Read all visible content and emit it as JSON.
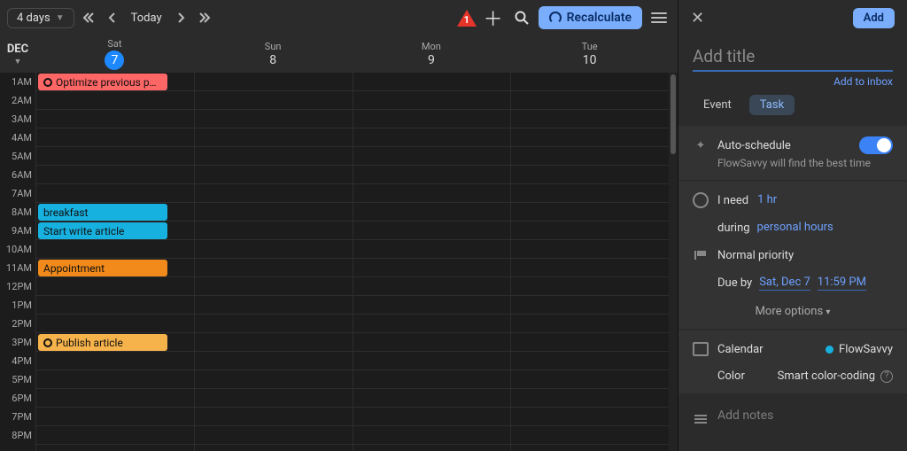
{
  "toolbar": {
    "range_label": "4 days",
    "today_label": "Today",
    "alert_count": "1",
    "recalculate_label": "Recalculate"
  },
  "month_label": "DEC",
  "days": [
    {
      "name": "Sat",
      "num": "7",
      "active": true
    },
    {
      "name": "Sun",
      "num": "8",
      "active": false
    },
    {
      "name": "Mon",
      "num": "9",
      "active": false
    },
    {
      "name": "Tue",
      "num": "10",
      "active": false
    }
  ],
  "times": [
    "1AM",
    "2AM",
    "3AM",
    "4AM",
    "5AM",
    "6AM",
    "7AM",
    "8AM",
    "9AM",
    "10AM",
    "11AM",
    "12PM",
    "1PM",
    "2PM",
    "3PM",
    "4PM",
    "5PM",
    "6PM",
    "7PM",
    "8PM"
  ],
  "events": [
    {
      "day": 0,
      "time_index": 0,
      "title": "Optimize previous p…",
      "color": "red",
      "circle": true
    },
    {
      "day": 0,
      "time_index": 7,
      "title": "breakfast",
      "color": "blue",
      "circle": false
    },
    {
      "day": 0,
      "time_index": 8,
      "title": "Start write article",
      "color": "blue",
      "circle": false
    },
    {
      "day": 0,
      "time_index": 10,
      "title": "Appointment",
      "color": "orange",
      "circle": false
    },
    {
      "day": 0,
      "time_index": 14,
      "title": "Publish article",
      "color": "lightorange",
      "circle": true
    }
  ],
  "panel": {
    "add_button": "Add",
    "title_placeholder": "Add title",
    "add_to_inbox": "Add to inbox",
    "tab_event": "Event",
    "tab_task": "Task",
    "auto_schedule_label": "Auto-schedule",
    "auto_schedule_desc": "FlowSavvy will find the best time",
    "need_label": "I need",
    "need_value": "1 hr",
    "during_label": "during",
    "during_value": "personal hours",
    "priority_label": "Normal priority",
    "due_label": "Due by",
    "due_date": "Sat, Dec 7",
    "due_time": "11:59 PM",
    "more_options": "More options",
    "calendar_label": "Calendar",
    "calendar_value": "FlowSavvy",
    "color_label": "Color",
    "color_value": "Smart color-coding",
    "notes_placeholder": "Add notes"
  }
}
